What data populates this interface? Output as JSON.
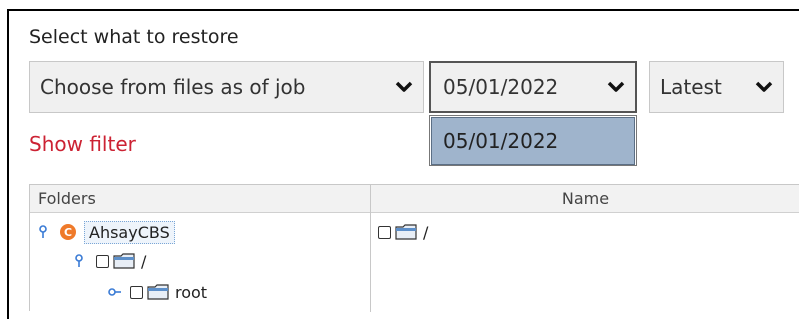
{
  "restore": {
    "section_label": "Select what to restore",
    "mode_select": {
      "value": "Choose from files as of job",
      "icon": "chevron-down-icon"
    },
    "date_select": {
      "value": "05/01/2022",
      "icon": "chevron-down-icon",
      "open": true
    },
    "date_options": [
      "05/01/2022"
    ],
    "version_select": {
      "value": "Latest",
      "icon": "chevron-down-icon"
    },
    "show_filter_label": "Show filter",
    "show_filter_color": "#cc2233"
  },
  "table": {
    "headers": {
      "folders": "Folders",
      "name": "Name"
    },
    "tree": [
      {
        "label": "AhsayCBS",
        "icon": "ahsay-app-icon",
        "icon_glyph": "C",
        "expanded": true
      },
      {
        "label": "/",
        "icon": "folder-icon",
        "expanded": true
      },
      {
        "label": "root",
        "icon": "folder-icon",
        "expanded": false
      }
    ],
    "name_rows": [
      {
        "label": "/",
        "icon": "folder-icon"
      }
    ]
  },
  "colors": {
    "selection": "#9fb4cc",
    "app_icon": "#ef7a2a"
  }
}
